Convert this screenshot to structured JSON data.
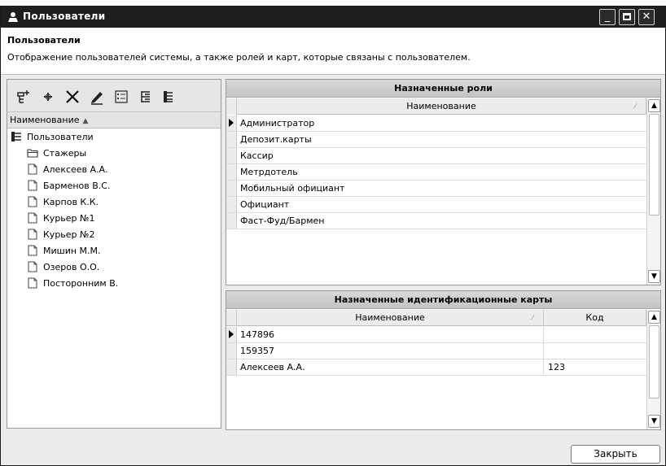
{
  "window": {
    "title": "Пользователи"
  },
  "header": {
    "title": "Пользователи",
    "description": "Отображение пользователей системы, а также ролей и карт, которые связаны с пользователем."
  },
  "left_panel": {
    "column_header": "Наименование",
    "tree": {
      "root": "Пользователи",
      "group": "Стажеры",
      "items": [
        "Алексеев А.А.",
        "Барменов В.С.",
        "Карпов К.К.",
        "Курьер №1",
        "Курьер №2",
        "Мишин М.М.",
        "Озеров О.О.",
        "Посторонним В."
      ]
    }
  },
  "roles_panel": {
    "title": "Назначенные роли",
    "column_header": "Наименование",
    "rows": [
      "Администратор",
      "Депозит.карты",
      "Кассир",
      "Метрдотель",
      "Мобильный официант",
      "Официант",
      "Фаст-Фуд/Бармен"
    ]
  },
  "cards_panel": {
    "title": "Назначенные идентификационные карты",
    "columns": [
      "Наименование",
      "Код"
    ],
    "rows": [
      {
        "name": "147896",
        "code": ""
      },
      {
        "name": "159357",
        "code": ""
      },
      {
        "name": "Алексеев А.А.",
        "code": "123"
      }
    ]
  },
  "footer": {
    "close_label": "Закрыть"
  }
}
